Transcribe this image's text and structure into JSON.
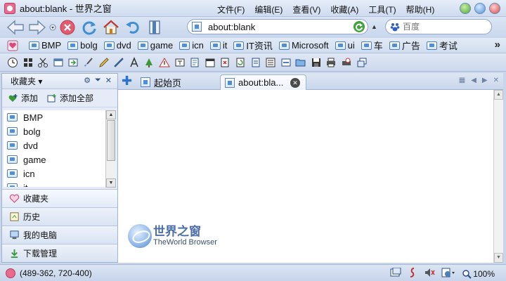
{
  "window": {
    "title": "about:blank - 世界之窗",
    "menu": [
      "文件(F)",
      "编辑(E)",
      "查看(V)",
      "收藏(A)",
      "工具(T)",
      "帮助(H)"
    ],
    "controls": [
      "minimize-icon",
      "maximize-icon",
      "close-icon"
    ]
  },
  "nav": {
    "buttons": [
      "back-icon",
      "forward-icon",
      "dropdown-icon",
      "stop-icon",
      "refresh-icon",
      "home-icon",
      "undo-icon",
      "bookmark-icon"
    ],
    "address_value": "about:blank",
    "search_placeholder": "百度"
  },
  "favorites_bar": {
    "items": [
      "BMP",
      "bolg",
      "dvd",
      "game",
      "icn",
      "it",
      "IT资讯",
      "Microsoft",
      "ui",
      "车",
      "广告",
      "考试"
    ],
    "more": "»"
  },
  "toolbar": {
    "icons": [
      "clock-icon",
      "grid-icon",
      "cut-icon",
      "window-icon",
      "go-window-icon",
      "brush-icon",
      "pencil-icon",
      "ruler-icon",
      "text-icon",
      "tree-icon",
      "warning-icon",
      "text-box-icon",
      "page-icon",
      "calendar-icon",
      "close-page-icon",
      "recycle-icon",
      "doc-icon",
      "list-icon",
      "card-icon",
      "folder-open-icon",
      "save-icon",
      "print-icon",
      "print-preview-icon",
      "window-restore-icon"
    ]
  },
  "sidebar": {
    "title": "收藏夹",
    "controls": [
      "gear-icon",
      "chevron-down-icon",
      "close-icon"
    ],
    "add_label": "添加",
    "add_all_label": "添加全部",
    "tree": [
      "BMP",
      "bolg",
      "dvd",
      "game",
      "icn",
      "it"
    ],
    "sections": [
      "收藏夹",
      "历史",
      "我的电脑",
      "下载管理"
    ]
  },
  "tabs": {
    "items": [
      "起始页",
      "about:bla..."
    ],
    "active": 1,
    "controls": [
      "tabs-grid-icon",
      "tab-prev-icon",
      "tab-next-icon",
      "tab-close-all-icon"
    ]
  },
  "brand": {
    "name": "世界之窗",
    "sub": "TheWorld Browser"
  },
  "status": {
    "text": "(489-362, 720-400)",
    "zoom": "100%",
    "icons": [
      "window-icon",
      "flash-icon",
      "mute-icon",
      "page-setup-icon",
      "zoom-icon"
    ]
  },
  "colors": {
    "chrome": "#c9d6ea",
    "accent": "#4d82c8",
    "brand": "#e86b8e"
  }
}
